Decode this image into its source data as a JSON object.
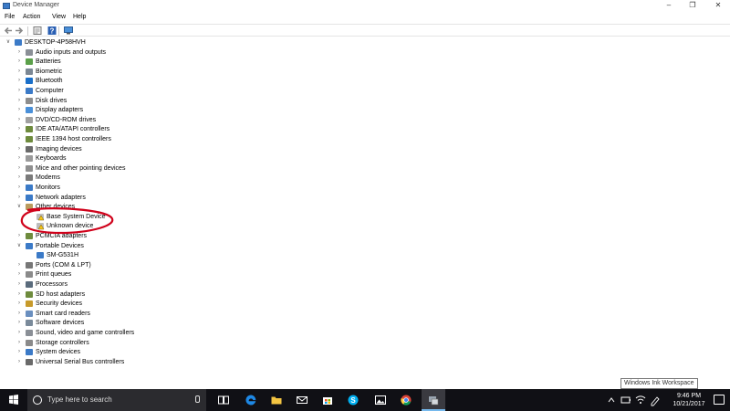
{
  "window": {
    "title": "Device Manager"
  },
  "menubar": {
    "items": [
      "File",
      "Action",
      "View",
      "Help"
    ]
  },
  "toolbar": {
    "buttons": [
      "back-icon",
      "forward-icon",
      "properties-icon",
      "help-icon",
      "display-icon"
    ]
  },
  "tree": {
    "root": "DESKTOP-4P58HVH",
    "categories": [
      {
        "label": "Audio inputs and outputs",
        "icon": "speaker-icon",
        "expanded": false
      },
      {
        "label": "Batteries",
        "icon": "battery-icon",
        "expanded": false
      },
      {
        "label": "Biometric",
        "icon": "biometric-icon",
        "expanded": false
      },
      {
        "label": "Bluetooth",
        "icon": "bluetooth-icon",
        "expanded": false
      },
      {
        "label": "Computer",
        "icon": "computer-icon",
        "expanded": false
      },
      {
        "label": "Disk drives",
        "icon": "disk-icon",
        "expanded": false
      },
      {
        "label": "Display adapters",
        "icon": "display-adapter-icon",
        "expanded": false
      },
      {
        "label": "DVD/CD-ROM drives",
        "icon": "dvd-icon",
        "expanded": false
      },
      {
        "label": "IDE ATA/ATAPI controllers",
        "icon": "ide-icon",
        "expanded": false
      },
      {
        "label": "IEEE 1394 host controllers",
        "icon": "ieee1394-icon",
        "expanded": false
      },
      {
        "label": "Imaging devices",
        "icon": "camera-icon",
        "expanded": false
      },
      {
        "label": "Keyboards",
        "icon": "keyboard-icon",
        "expanded": false
      },
      {
        "label": "Mice and other pointing devices",
        "icon": "mouse-icon",
        "expanded": false
      },
      {
        "label": "Modems",
        "icon": "modem-icon",
        "expanded": false
      },
      {
        "label": "Monitors",
        "icon": "monitor-icon",
        "expanded": false
      },
      {
        "label": "Network adapters",
        "icon": "network-icon",
        "expanded": false
      },
      {
        "label": "Other devices",
        "icon": "other-devices-icon",
        "expanded": true,
        "children": [
          {
            "label": "Base System Device",
            "icon": "warning-device-icon"
          },
          {
            "label": "Unknown device",
            "icon": "warning-device-icon"
          }
        ]
      },
      {
        "label": "PCMCIA adapters",
        "icon": "pcmcia-icon",
        "expanded": false
      },
      {
        "label": "Portable Devices",
        "icon": "portable-device-icon",
        "expanded": true,
        "children": [
          {
            "label": "SM-G531H",
            "icon": "phone-icon"
          }
        ]
      },
      {
        "label": "Ports (COM & LPT)",
        "icon": "port-icon",
        "expanded": false
      },
      {
        "label": "Print queues",
        "icon": "printer-icon",
        "expanded": false
      },
      {
        "label": "Processors",
        "icon": "processor-icon",
        "expanded": false
      },
      {
        "label": "SD host adapters",
        "icon": "sd-icon",
        "expanded": false
      },
      {
        "label": "Security devices",
        "icon": "security-icon",
        "expanded": false
      },
      {
        "label": "Smart card readers",
        "icon": "smartcard-icon",
        "expanded": false
      },
      {
        "label": "Software devices",
        "icon": "software-device-icon",
        "expanded": false
      },
      {
        "label": "Sound, video and game controllers",
        "icon": "sound-icon",
        "expanded": false
      },
      {
        "label": "Storage controllers",
        "icon": "storage-icon",
        "expanded": false
      },
      {
        "label": "System devices",
        "icon": "system-icon",
        "expanded": false
      },
      {
        "label": "Universal Serial Bus controllers",
        "icon": "usb-icon",
        "expanded": false
      }
    ]
  },
  "tooltip": {
    "text": "Windows Ink Workspace"
  },
  "taskbar": {
    "search_placeholder": "Type here to search",
    "apps": [
      "task-view-icon",
      "edge-icon",
      "mail-icon",
      "store-icon",
      "skype-icon",
      "photos-icon",
      "chrome-icon",
      "device-manager-icon"
    ],
    "time": "9:46 PM",
    "date": "10/21/2017"
  },
  "colors": {
    "taskbar": "#101015",
    "annotation": "#d0021b",
    "icon_blue": "#3b7ac7"
  }
}
